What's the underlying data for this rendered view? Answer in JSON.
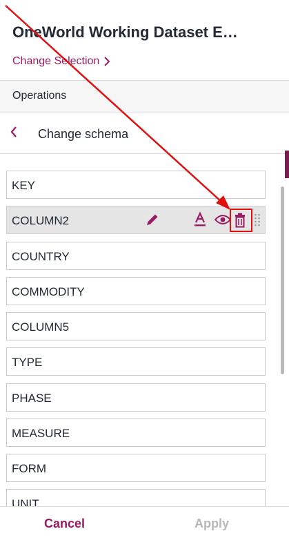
{
  "header": {
    "title": "OneWorld Working Dataset E…",
    "change_selection": "Change Selection"
  },
  "section": {
    "label": "Operations"
  },
  "nav": {
    "back_label": "Change schema"
  },
  "columns": [
    {
      "name": "KEY"
    },
    {
      "name": "COLUMN2",
      "selected": true
    },
    {
      "name": "COUNTRY"
    },
    {
      "name": "COMMODITY"
    },
    {
      "name": "COLUMN5"
    },
    {
      "name": "TYPE"
    },
    {
      "name": "PHASE"
    },
    {
      "name": "MEASURE"
    },
    {
      "name": "FORM"
    },
    {
      "name": "UNIT"
    }
  ],
  "row_actions": [
    "pencil-icon",
    "text-format-icon",
    "eye-icon",
    "trash-icon",
    "drag-handle-icon"
  ],
  "footer": {
    "cancel": "Cancel",
    "apply": "Apply"
  },
  "colors": {
    "accent": "#9b1b63",
    "annotation": "#e01010",
    "disabled": "#b8b8b8"
  }
}
